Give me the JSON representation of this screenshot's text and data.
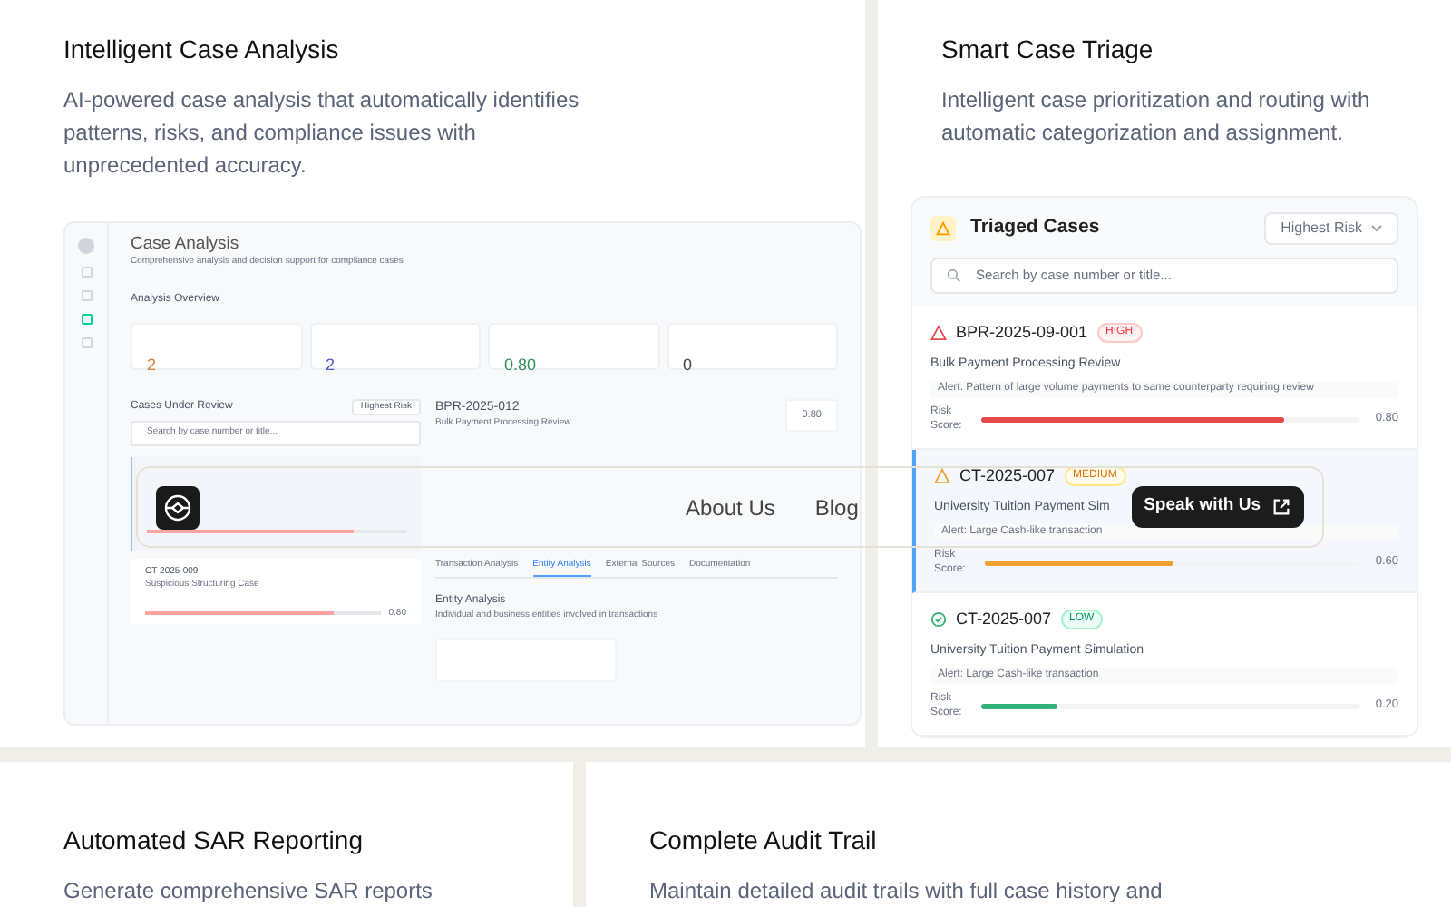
{
  "features": [
    {
      "title": "Intelligent Case Analysis",
      "description": "AI-powered case analysis that automatically identifies patterns, risks, and compliance issues with unprecedented accuracy."
    },
    {
      "title": "Smart Case Triage",
      "description": "Intelligent case prioritization and routing with automatic categorization and assignment."
    },
    {
      "title": "Automated SAR Reporting",
      "description": "Generate comprehensive SAR reports"
    },
    {
      "title": "Complete Audit Trail",
      "description": "Maintain detailed audit trails with full case history and"
    }
  ],
  "analysis_preview": {
    "title": "Case Analysis",
    "subtitle": "Comprehensive analysis and decision support for compliance cases",
    "overview_title": "Analysis Overview",
    "stats": [
      {
        "value": "2",
        "color": "#e07b39"
      },
      {
        "value": "2",
        "color": "#4f5bd5"
      },
      {
        "value": "0.80",
        "color": "#2f8f5b"
      },
      {
        "value": "0",
        "color": "#444444"
      }
    ],
    "cases_title": "Cases Under Review",
    "sort": "Highest Risk",
    "search_placeholder": "Search by case number or title...",
    "cases": [
      {
        "selected": true,
        "level": 0.8
      },
      {
        "id": "CT-2025-009",
        "title": "Suspicious Structuring Case",
        "selected": false,
        "level": 0.8,
        "reading": "0.80"
      }
    ],
    "detail": {
      "case_id": "BPR-2025-012",
      "case_title": "Bulk Payment Processing Review",
      "score": "0.80",
      "tabs": [
        {
          "label": "Transaction Analysis",
          "selected": false
        },
        {
          "label": "Entity Analysis",
          "selected": true
        },
        {
          "label": "External Sources",
          "selected": false
        },
        {
          "label": "Documentation",
          "selected": false
        }
      ],
      "section_title": "Entity Analysis",
      "section_subtitle": "Individual and business entities involved in transactions"
    }
  },
  "triage": {
    "title": "Triaged Cases",
    "sort": "Highest Risk",
    "search_placeholder": "Search by case number or title...",
    "cases": [
      {
        "id": "BPR-2025-09-001",
        "priority": "HIGH",
        "kind": "alert",
        "title": "Bulk Payment Processing Review",
        "alert": "Alert: Pattern of large volume payments to same counterparty requiring review",
        "risk_label": "Risk Score:",
        "level": 0.8,
        "reading": "0.80",
        "color": "#e5484d",
        "selected": false
      },
      {
        "id": "CT-2025-007",
        "priority": "MEDIUM",
        "kind": "alert",
        "title": "University Tuition Payment Sim",
        "alert": "Alert: Large Cash-like transaction",
        "risk_label": "Risk Score:",
        "level": 0.5,
        "reading": "0.60",
        "color": "#f0a030",
        "selected": true
      },
      {
        "id": "CT-2025-007",
        "priority": "LOW",
        "kind": "ok",
        "title": "University Tuition Payment Simulation",
        "alert": "Alert: Large Cash-like transaction",
        "risk_label": "Risk Score:",
        "level": 0.2,
        "reading": "0.20",
        "color": "#34b27b",
        "selected": false
      }
    ]
  },
  "navbar": {
    "links": [
      "About Us",
      "Blog"
    ],
    "cta": "Speak with Us"
  }
}
